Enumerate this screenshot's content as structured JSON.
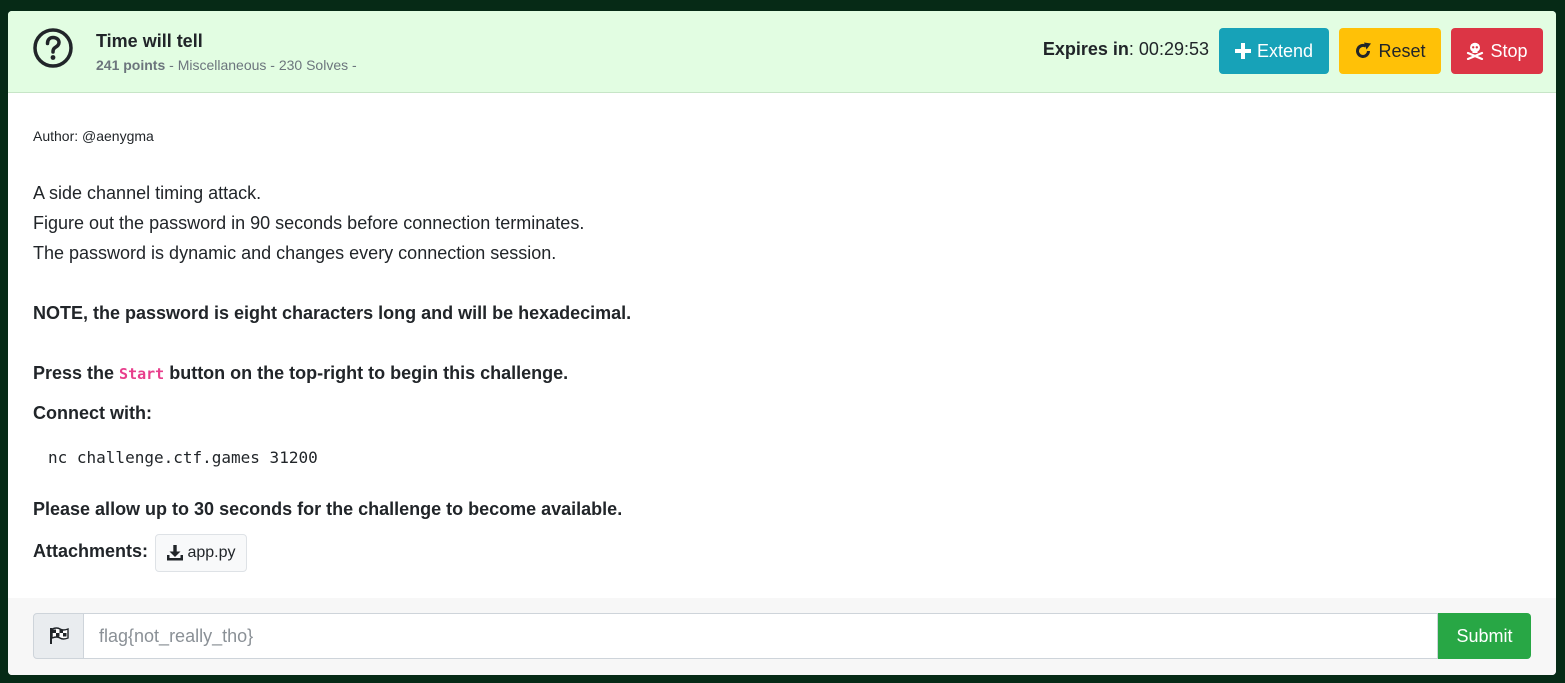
{
  "challenge": {
    "title": "Time will tell",
    "points": "241 points",
    "meta": " - Miscellaneous - 230 Solves -"
  },
  "timer": {
    "label": "Expires in",
    "value": ": 00:29:53"
  },
  "actions": {
    "extend_label": "Extend",
    "reset_label": "Reset",
    "stop_label": "Stop"
  },
  "body": {
    "author": "Author: @aenygma",
    "lines": [
      "A side channel timing attack.",
      "Figure out the password in 90 seconds before connection terminates.",
      "The password is dynamic and changes every connection session."
    ],
    "note": "NOTE, the password is eight characters long and will be hexadecimal.",
    "press_prefix": "Press the ",
    "press_code": "Start",
    "press_suffix": " button on the top-right to begin this challenge.",
    "connect_label": "Connect with:",
    "command": "nc challenge.ctf.games 31200",
    "allow_note": "Please allow up to 30 seconds for the challenge to become available.",
    "attachments_label": "Attachments:",
    "attachment_name": "app.py"
  },
  "submission": {
    "placeholder": "flag{not_really_tho}",
    "submit_label": "Submit"
  },
  "colors": {
    "header_bg": "#e2fde2",
    "extend": "#17a2b8",
    "reset": "#ffc107",
    "stop": "#dc3545",
    "submit": "#28a745",
    "code": "#e83e8c"
  },
  "icons": {
    "header": "question-circle-icon",
    "extend": "plus-icon",
    "reset": "redo-icon",
    "stop": "skull-crossbones-icon",
    "attachment": "download-icon",
    "flag": "checkered-flag-icon"
  }
}
